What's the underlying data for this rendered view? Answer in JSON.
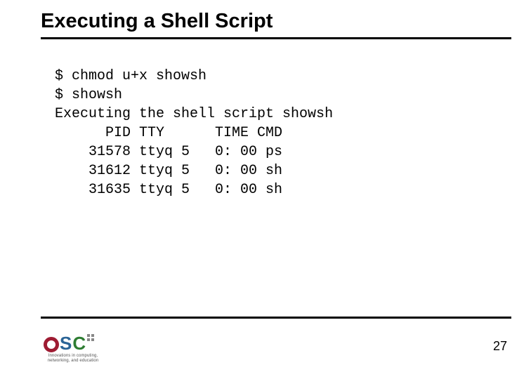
{
  "slide": {
    "title": "Executing a Shell Script",
    "page_number": "27"
  },
  "terminal": {
    "line1": "$ chmod u+x showsh",
    "line2": "$ showsh",
    "line3": "Executing the shell script showsh",
    "line4": "      PID TTY      TIME CMD",
    "line5": "    31578 ttyq 5   0: 00 ps",
    "line6": "    31612 ttyq 5   0: 00 sh",
    "line7": "    31635 ttyq 5   0: 00 sh"
  },
  "logo": {
    "name": "OSC",
    "tagline": "Innovations in computing, networking, and education"
  }
}
